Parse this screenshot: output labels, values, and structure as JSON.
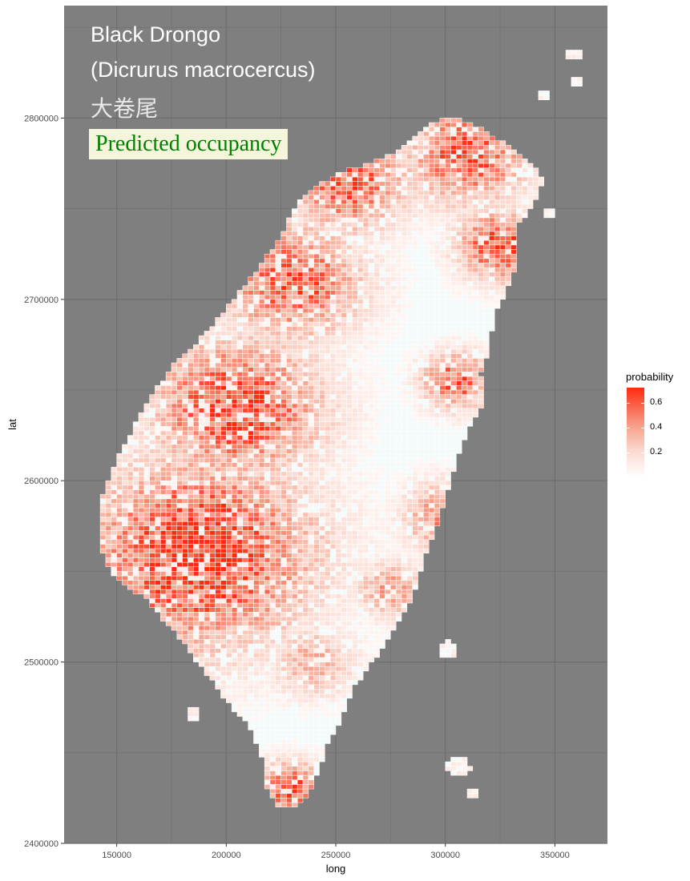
{
  "title": {
    "line1": "Black Drongo",
    "line2": "(Dicrurus macrocercus)",
    "line3": "大卷尾",
    "label": "Predicted occupancy"
  },
  "colors": {
    "panel_bg": "#7f7f7f",
    "grid": "#6e6e6e",
    "land_base": "#f4fafa",
    "cell_border": "#ffffff",
    "high": "#ff2a10",
    "mid": "#f79a83",
    "low": "#fbd9cf",
    "label_bg": "#f5f5dc",
    "label_text": "#008000"
  },
  "chart_data": {
    "type": "heatmap",
    "xlabel": "long",
    "ylabel": "lat",
    "xlim": [
      126000,
      374000
    ],
    "ylim": [
      2400000,
      2862000
    ],
    "x_ticks": [
      150000,
      200000,
      250000,
      300000,
      350000
    ],
    "y_ticks": [
      2400000,
      2500000,
      2600000,
      2700000,
      2800000
    ],
    "x_tick_labels": [
      "150000",
      "200000",
      "250000",
      "300000",
      "350000"
    ],
    "y_tick_labels": [
      "2400000",
      "2500000",
      "2600000",
      "2700000",
      "2800000"
    ],
    "grid": true,
    "legend": {
      "title": "probability",
      "position": "right",
      "ticks": [
        0.2,
        0.4,
        0.6
      ],
      "tick_labels": [
        "0.2",
        "0.4",
        "0.6"
      ],
      "range": [
        0.0,
        0.72
      ]
    },
    "taiwan_outline": [
      [
        305000,
        2800000
      ],
      [
        315000,
        2795000
      ],
      [
        328000,
        2785000
      ],
      [
        338000,
        2775000
      ],
      [
        345000,
        2767000
      ],
      [
        340000,
        2752000
      ],
      [
        333000,
        2740000
      ],
      [
        333000,
        2720000
      ],
      [
        328000,
        2705000
      ],
      [
        322000,
        2690000
      ],
      [
        320000,
        2672000
      ],
      [
        316000,
        2660000
      ],
      [
        318000,
        2643000
      ],
      [
        310000,
        2628000
      ],
      [
        305000,
        2610000
      ],
      [
        300000,
        2590000
      ],
      [
        295000,
        2570000
      ],
      [
        289000,
        2552000
      ],
      [
        285000,
        2535000
      ],
      [
        277000,
        2520000
      ],
      [
        268000,
        2502000
      ],
      [
        258000,
        2485000
      ],
      [
        253000,
        2470000
      ],
      [
        247000,
        2457000
      ],
      [
        243000,
        2443000
      ],
      [
        238000,
        2427000
      ],
      [
        232000,
        2420000
      ],
      [
        224000,
        2420000
      ],
      [
        218000,
        2432000
      ],
      [
        217000,
        2445000
      ],
      [
        212000,
        2462000
      ],
      [
        200000,
        2478000
      ],
      [
        194000,
        2490000
      ],
      [
        186000,
        2500000
      ],
      [
        180000,
        2512000
      ],
      [
        172000,
        2522000
      ],
      [
        163000,
        2535000
      ],
      [
        150000,
        2545000
      ],
      [
        144000,
        2557000
      ],
      [
        142000,
        2573000
      ],
      [
        143000,
        2590000
      ],
      [
        148000,
        2605000
      ],
      [
        152000,
        2617000
      ],
      [
        158000,
        2630000
      ],
      [
        167000,
        2648000
      ],
      [
        175000,
        2663000
      ],
      [
        186000,
        2675000
      ],
      [
        195000,
        2688000
      ],
      [
        205000,
        2702000
      ],
      [
        215000,
        2717000
      ],
      [
        225000,
        2735000
      ],
      [
        232000,
        2752000
      ],
      [
        240000,
        2762000
      ],
      [
        252000,
        2770000
      ],
      [
        262000,
        2774000
      ],
      [
        272000,
        2778000
      ],
      [
        282000,
        2785000
      ],
      [
        292000,
        2795000
      ],
      [
        298000,
        2800000
      ]
    ],
    "islands": [
      [
        359000,
        2835000,
        3500
      ],
      [
        361000,
        2820000,
        3000
      ],
      [
        345000,
        2813000,
        2500
      ],
      [
        348000,
        2748000,
        3000
      ],
      [
        185000,
        2471000,
        3500
      ],
      [
        301000,
        2507000,
        4500
      ],
      [
        306000,
        2442000,
        5500
      ],
      [
        313000,
        2427000,
        3000
      ]
    ],
    "hot_zones": [
      [
        188000,
        2560000,
        40000,
        0.65
      ],
      [
        205000,
        2640000,
        30000,
        0.6
      ],
      [
        230000,
        2710000,
        25000,
        0.55
      ],
      [
        255000,
        2765000,
        22000,
        0.55
      ],
      [
        310000,
        2780000,
        22000,
        0.55
      ],
      [
        325000,
        2730000,
        15000,
        0.6
      ],
      [
        305000,
        2655000,
        12000,
        0.55
      ],
      [
        300000,
        2580000,
        15000,
        0.45
      ],
      [
        275000,
        2540000,
        12000,
        0.4
      ],
      [
        230000,
        2430000,
        12000,
        0.55
      ],
      [
        240000,
        2500000,
        15000,
        0.35
      ]
    ]
  }
}
